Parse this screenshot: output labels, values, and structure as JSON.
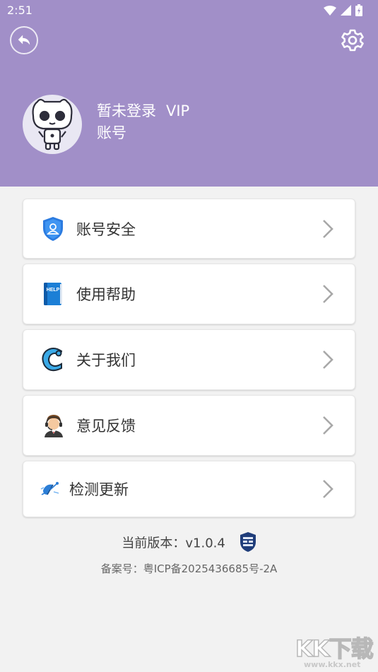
{
  "status": {
    "time": "2:51"
  },
  "profile": {
    "name": "暂未登录",
    "vip": "VIP",
    "sub": "账号"
  },
  "menu": [
    {
      "label": "账号安全",
      "icon": "shield-user-icon"
    },
    {
      "label": "使用帮助",
      "icon": "help-book-icon"
    },
    {
      "label": "关于我们",
      "icon": "c-logo-icon"
    },
    {
      "label": "意见反馈",
      "icon": "support-agent-icon"
    },
    {
      "label": "检测更新",
      "icon": "satellite-icon"
    }
  ],
  "footer": {
    "version": "当前版本：v1.0.4",
    "icp": "备案号：粤ICP备2025436685号-2A"
  },
  "watermark": {
    "brand": "KK下载",
    "url": "www.kkx.net"
  },
  "colors": {
    "header": "#a18fc8",
    "background": "#f2f2f2",
    "card": "#ffffff"
  }
}
